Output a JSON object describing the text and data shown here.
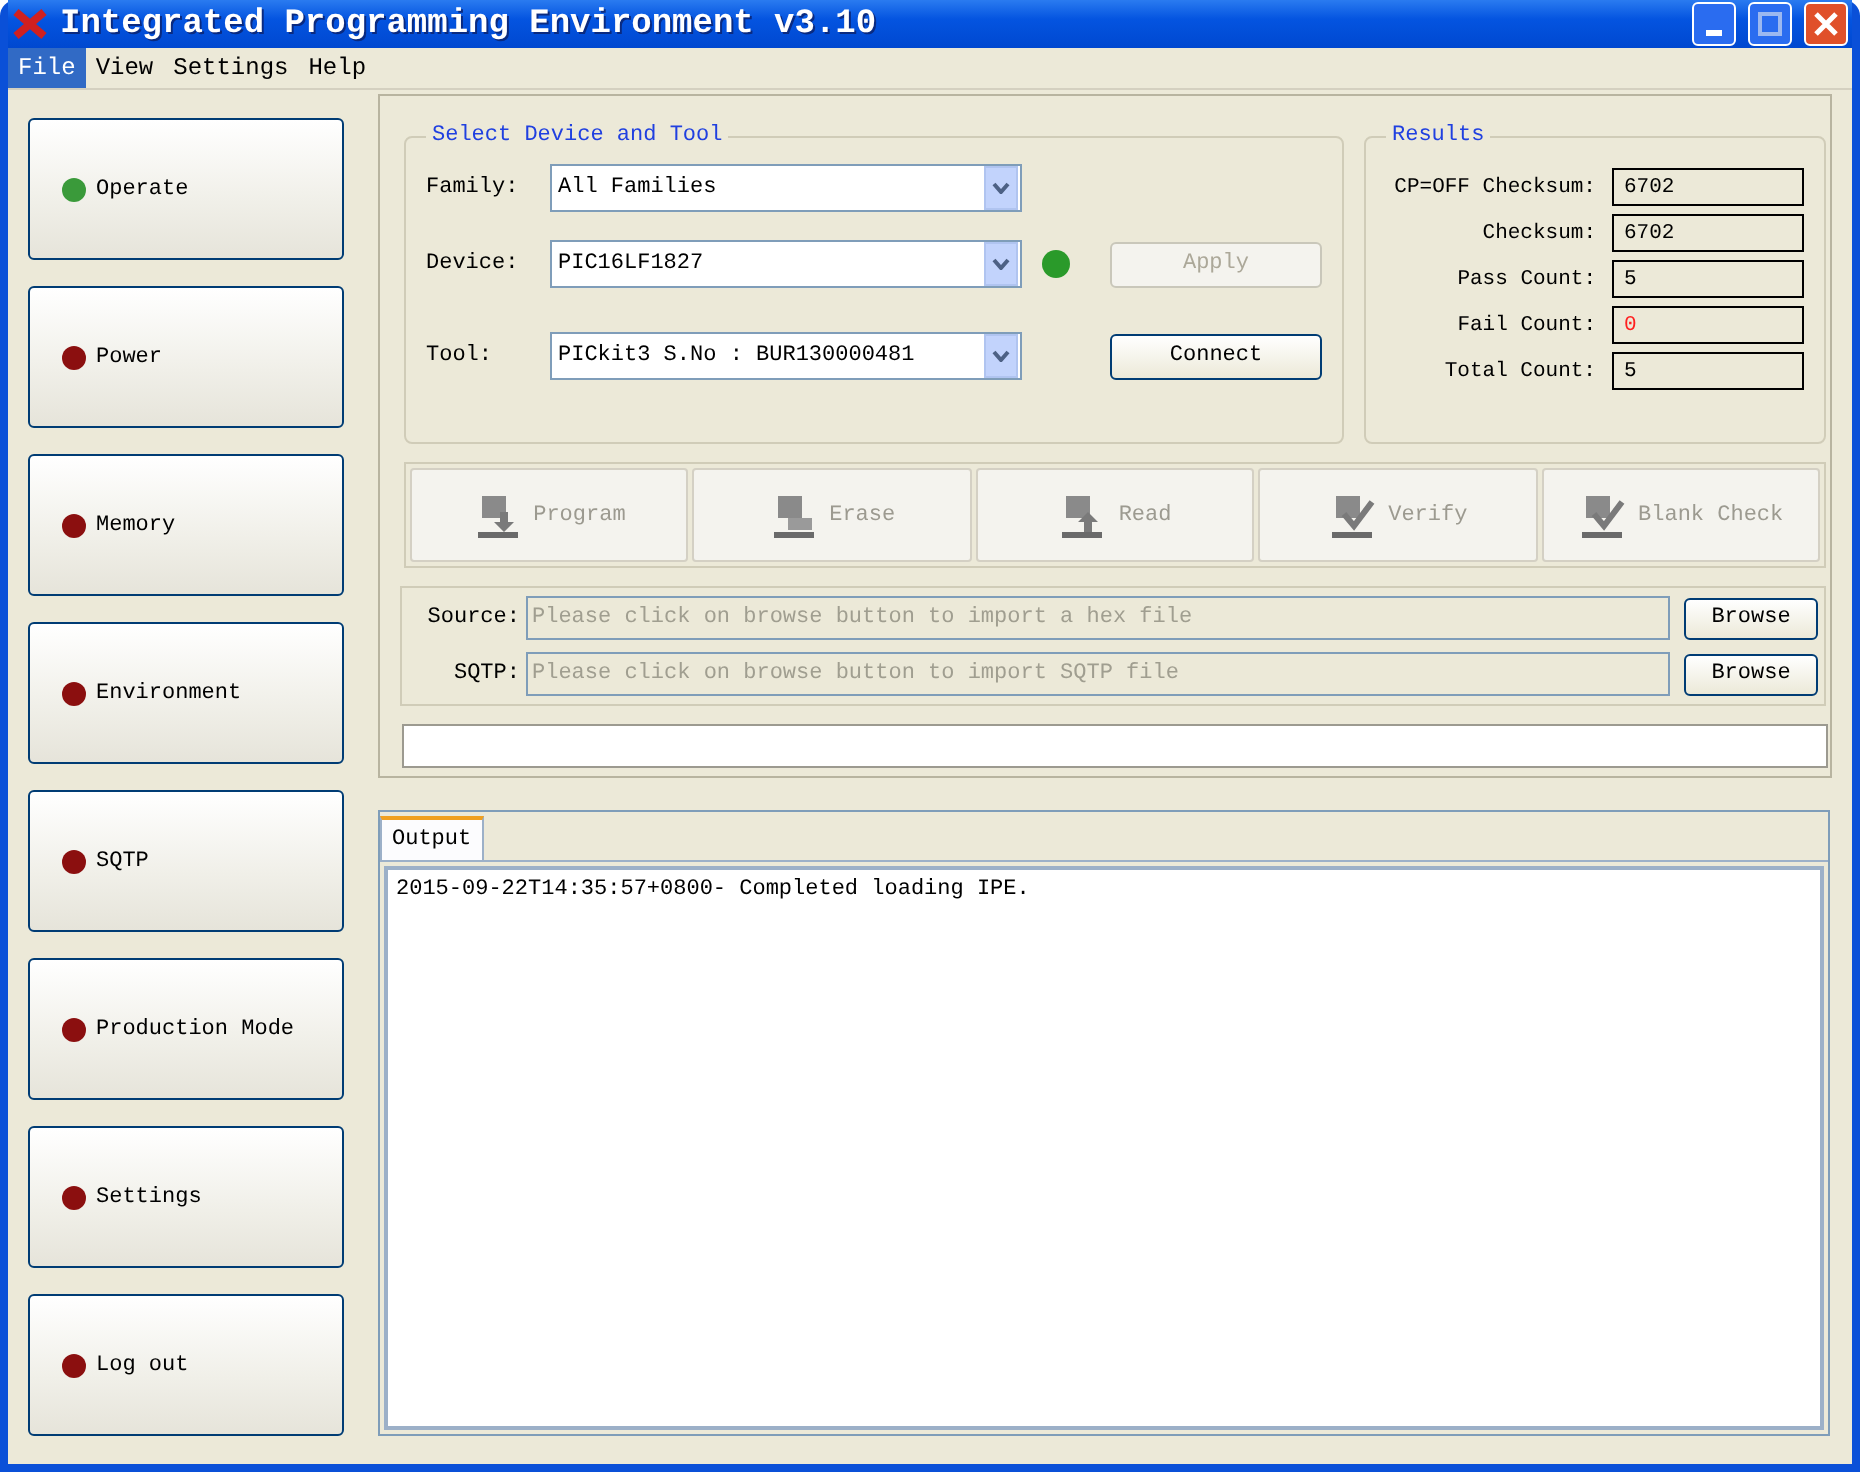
{
  "window": {
    "title": "Integrated Programming Environment v3.10"
  },
  "menu": [
    {
      "label": "File",
      "selected": true
    },
    {
      "label": "View",
      "selected": false
    },
    {
      "label": "Settings",
      "selected": false
    },
    {
      "label": "Help",
      "selected": false
    }
  ],
  "sidebar": {
    "items": [
      {
        "label": "Operate",
        "color": "#3a9a3a"
      },
      {
        "label": "Power",
        "color": "#8b0f0f"
      },
      {
        "label": "Memory",
        "color": "#8b0f0f"
      },
      {
        "label": "Environment",
        "color": "#8b0f0f"
      },
      {
        "label": "SQTP",
        "color": "#8b0f0f"
      },
      {
        "label": "Production Mode",
        "color": "#8b0f0f"
      },
      {
        "label": "Settings",
        "color": "#8b0f0f"
      },
      {
        "label": "Log out",
        "color": "#8b0f0f"
      }
    ]
  },
  "device_group": {
    "title": "Select Device and Tool",
    "family": {
      "label": "Family:",
      "value": "All Families"
    },
    "device": {
      "label": "Device:",
      "value": "PIC16LF1827",
      "ready": true
    },
    "tool": {
      "label": "Tool:",
      "value": "PICkit3 S.No : BUR130000481"
    },
    "apply_button": {
      "label": "Apply",
      "disabled": true
    },
    "connect_button": {
      "label": "Connect",
      "disabled": false
    }
  },
  "results": {
    "title": "Results",
    "rows": [
      {
        "label": "CP=OFF Checksum:",
        "value": "6702",
        "alert": false
      },
      {
        "label": "Checksum:",
        "value": "6702",
        "alert": false
      },
      {
        "label": "Pass Count:",
        "value": "5",
        "alert": false
      },
      {
        "label": "Fail Count:",
        "value": "0",
        "alert": true
      },
      {
        "label": "Total Count:",
        "value": "5",
        "alert": false
      }
    ]
  },
  "actions": [
    {
      "label": "Program",
      "kind": "program",
      "disabled": true
    },
    {
      "label": "Erase",
      "kind": "erase",
      "disabled": true
    },
    {
      "label": "Read",
      "kind": "read",
      "disabled": true
    },
    {
      "label": "Verify",
      "kind": "verify",
      "disabled": true
    },
    {
      "label": "Blank Check",
      "kind": "blank",
      "disabled": true
    }
  ],
  "files": [
    {
      "label": "Source:",
      "placeholder": "Please click on browse button to import a hex file",
      "button": "Browse"
    },
    {
      "label": "SQTP:",
      "placeholder": "Please click on browse button to import SQTP file",
      "button": "Browse"
    }
  ],
  "output": {
    "tab": {
      "label": "Output",
      "selected": true
    },
    "lines": [
      "2015-09-22T14:35:57+0800- Completed loading IPE."
    ]
  }
}
